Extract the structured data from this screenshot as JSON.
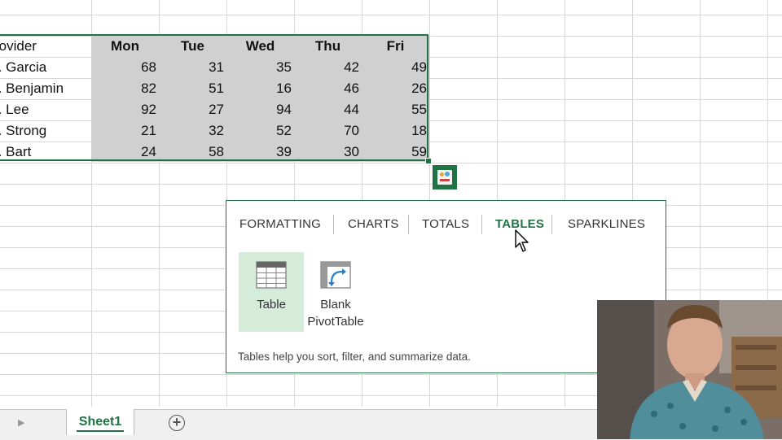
{
  "spreadsheet": {
    "header": [
      "rovider",
      "Mon",
      "Tue",
      "Wed",
      "Thu",
      "Fri"
    ],
    "rows": [
      {
        "provider": "r. Garcia",
        "values": [
          "68",
          "31",
          "35",
          "42",
          "49"
        ]
      },
      {
        "provider": "r. Benjamin",
        "values": [
          "82",
          "51",
          "16",
          "46",
          "26"
        ]
      },
      {
        "provider": "r. Lee",
        "values": [
          "92",
          "27",
          "94",
          "44",
          "55"
        ]
      },
      {
        "provider": "r. Strong",
        "values": [
          "21",
          "32",
          "52",
          "70",
          "18"
        ]
      },
      {
        "provider": "r. Bart",
        "values": [
          "24",
          "58",
          "39",
          "30",
          "59"
        ]
      }
    ]
  },
  "quick_analysis": {
    "icon": "quick-analysis-icon",
    "tabs": [
      {
        "label": "FORMATTING",
        "active": false
      },
      {
        "label": "CHARTS",
        "active": false
      },
      {
        "label": "TOTALS",
        "active": false
      },
      {
        "label": "TABLES",
        "active": true
      },
      {
        "label": "SPARKLINES",
        "active": false
      }
    ],
    "options": [
      {
        "label": "Table",
        "icon": "table-icon",
        "selected": true
      },
      {
        "label_line1": "Blank",
        "label_line2": "PivotTable",
        "icon": "pivot-table-icon",
        "selected": false
      }
    ],
    "description": "Tables help you sort, filter, and summarize data."
  },
  "sheet_tabs": {
    "active": "Sheet1",
    "add_icon": "plus-circle-icon",
    "nav_icon": "scroll-right-icon"
  },
  "colors": {
    "accent": "#217346",
    "selection_fill": "#d0d0d0",
    "option_selected": "#d4ecd9"
  }
}
